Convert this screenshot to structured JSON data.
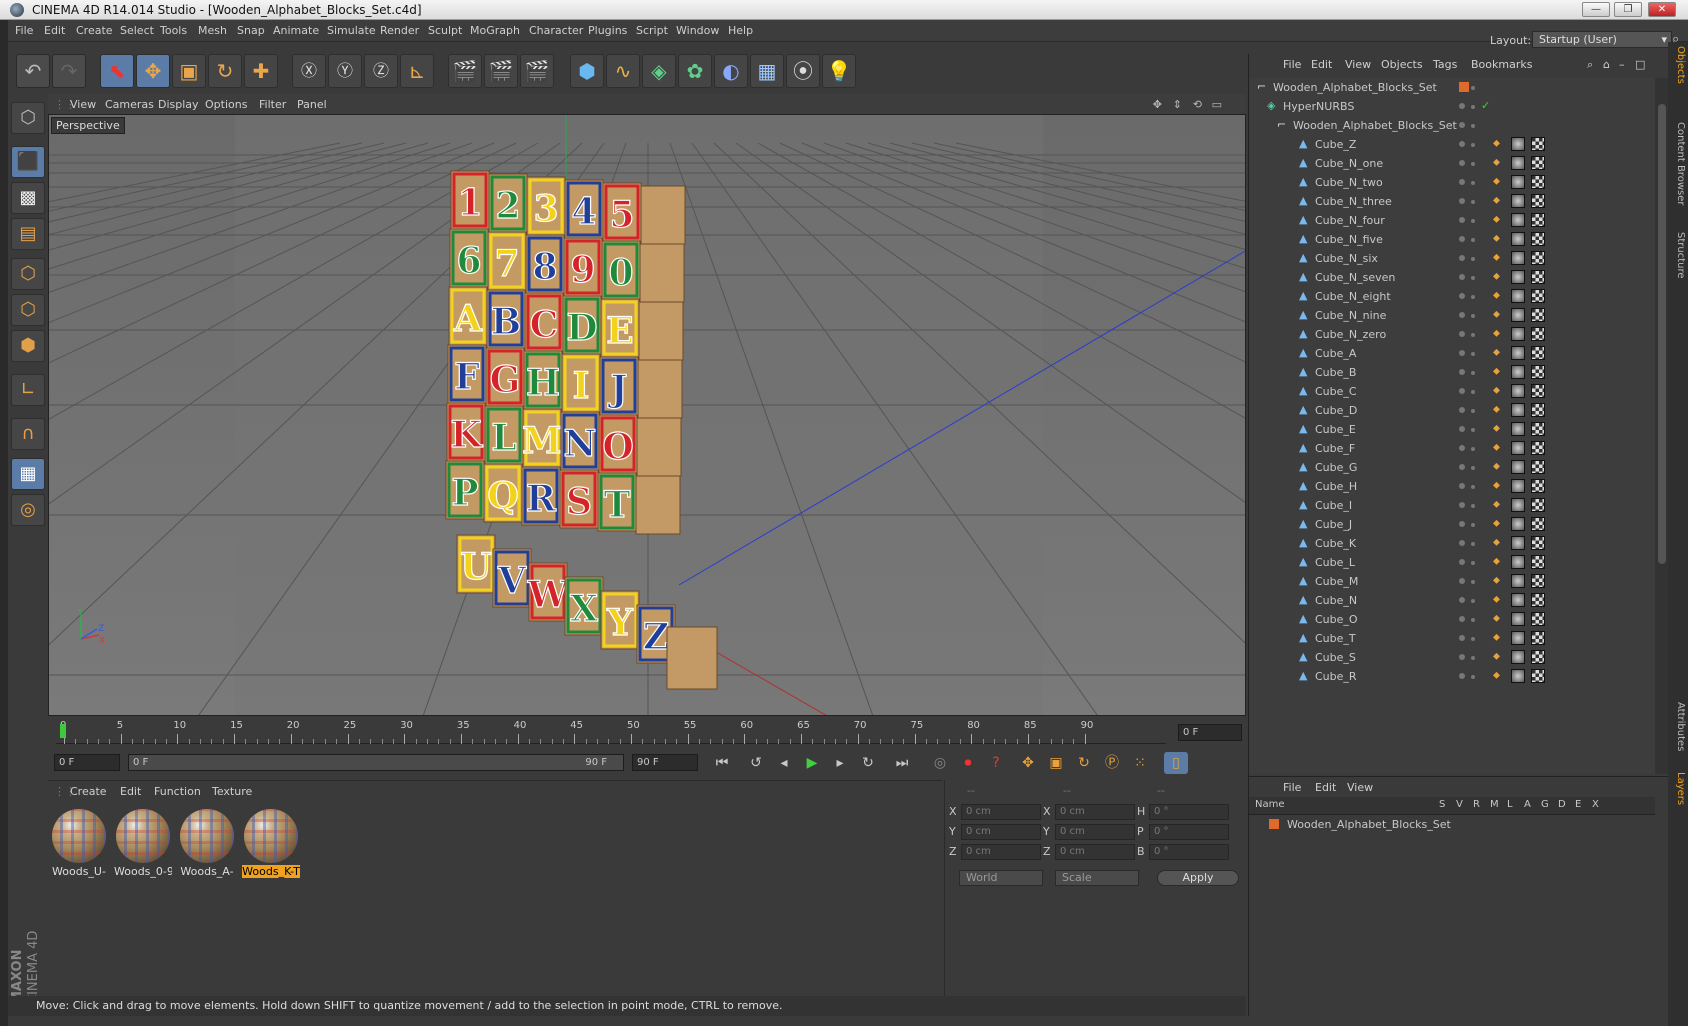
{
  "window": {
    "title": "CINEMA 4D R14.014 Studio - [Wooden_Alphabet_Blocks_Set.c4d]",
    "minimize": "—",
    "restore": "❐",
    "close": "✕"
  },
  "menubar": {
    "items": [
      "File",
      "Edit",
      "Create",
      "Select",
      "Tools",
      "Mesh",
      "Snap",
      "Animate",
      "Simulate",
      "Render",
      "Sculpt",
      "MoGraph",
      "Character",
      "Plugins",
      "Script",
      "Window",
      "Help"
    ],
    "layout_label": "Layout:",
    "layout_value": "Startup (User)"
  },
  "viewport": {
    "menu": [
      "View",
      "Cameras",
      "Display",
      "Options",
      "Filter",
      "Panel"
    ],
    "label": "Perspective",
    "axis": {
      "x": "X",
      "y": "Y",
      "z": "Z"
    }
  },
  "blocks": {
    "rows": [
      [
        "1",
        "2",
        "3",
        "4",
        "5"
      ],
      [
        "6",
        "7",
        "8",
        "9",
        "0"
      ],
      [
        "A",
        "B",
        "C",
        "D",
        "E"
      ],
      [
        "F",
        "G",
        "H",
        "I",
        "J"
      ],
      [
        "K",
        "L",
        "M",
        "N",
        "O"
      ],
      [
        "P",
        "Q",
        "R",
        "S",
        "T"
      ],
      [
        "U",
        "V",
        "W",
        "X",
        "Y",
        "Z"
      ]
    ],
    "colors": {
      "red": "#d4242a",
      "green": "#1f8a3c",
      "yellow": "#f2d21c",
      "blue": "#1f3f9a",
      "wood": "#c49a64"
    }
  },
  "timeline": {
    "ticks": [
      "0",
      "5",
      "10",
      "15",
      "20",
      "25",
      "30",
      "35",
      "40",
      "45",
      "50",
      "55",
      "60",
      "65",
      "70",
      "75",
      "80",
      "85",
      "90"
    ],
    "current_frame": "0 F"
  },
  "timecontrol": {
    "start": "0 F",
    "range_start": "0 F",
    "range_end": "90 F",
    "end": "90 F"
  },
  "materials": {
    "menu": [
      "Create",
      "Edit",
      "Function",
      "Texture"
    ],
    "items": [
      "Woods_U-",
      "Woods_0-9",
      "Woods_A-",
      "Woods_K-T"
    ],
    "selected_index": 3
  },
  "coords": {
    "headers": [
      "--",
      "--",
      "--"
    ],
    "rows": [
      {
        "a": "X",
        "av": "0 cm",
        "b": "X",
        "bv": "0 cm",
        "c": "H",
        "cv": "0 °"
      },
      {
        "a": "Y",
        "av": "0 cm",
        "b": "Y",
        "bv": "0 cm",
        "c": "P",
        "cv": "0 °"
      },
      {
        "a": "Z",
        "av": "0 cm",
        "b": "Z",
        "bv": "0 cm",
        "c": "B",
        "cv": "0 °"
      }
    ],
    "world": "World",
    "scale": "Scale",
    "apply": "Apply"
  },
  "status": "Move: Click and drag to move elements. Hold down SHIFT to quantize movement / add to the selection in point mode, CTRL to remove.",
  "objects": {
    "menu": [
      "File",
      "Edit",
      "View",
      "Objects",
      "Tags",
      "Bookmarks"
    ],
    "root": "Wooden_Alphabet_Blocks_Set",
    "hypernurbs": "HyperNURBS",
    "group": "Wooden_Alphabet_Blocks_Set",
    "cubes": [
      "Cube_Z",
      "Cube_N_one",
      "Cube_N_two",
      "Cube_N_three",
      "Cube_N_four",
      "Cube_N_five",
      "Cube_N_six",
      "Cube_N_seven",
      "Cube_N_eight",
      "Cube_N_nine",
      "Cube_N_zero",
      "Cube_A",
      "Cube_B",
      "Cube_C",
      "Cube_D",
      "Cube_E",
      "Cube_F",
      "Cube_G",
      "Cube_H",
      "Cube_I",
      "Cube_J",
      "Cube_K",
      "Cube_L",
      "Cube_M",
      "Cube_N",
      "Cube_O",
      "Cube_T",
      "Cube_S",
      "Cube_R"
    ]
  },
  "layers": {
    "menu": [
      "File",
      "Edit",
      "View"
    ],
    "columns": [
      "Name",
      "S",
      "V",
      "R",
      "M",
      "L",
      "A",
      "G",
      "D",
      "E",
      "X"
    ],
    "row": "Wooden_Alphabet_Blocks_Set"
  },
  "sidetabs": [
    "Objects",
    "Content Browser",
    "Structure",
    "Attributes",
    "Layers"
  ],
  "branding": {
    "maxon": "MAXON",
    "cinema": "CINEMA 4D"
  }
}
